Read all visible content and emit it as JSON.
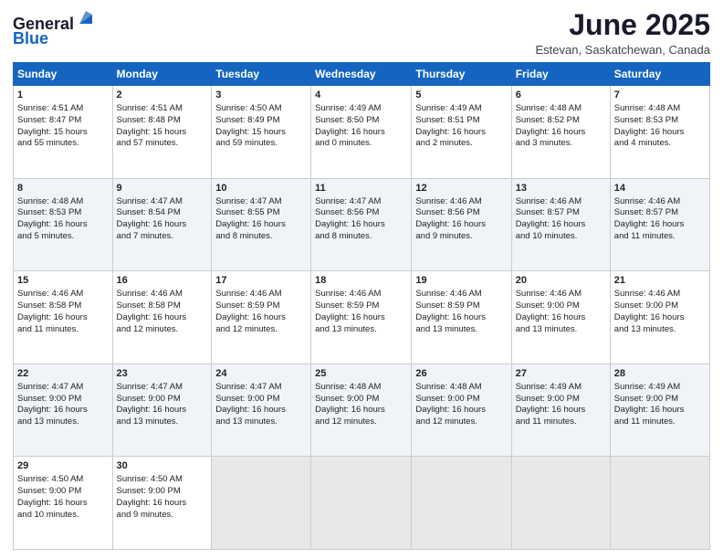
{
  "header": {
    "logo_general": "General",
    "logo_blue": "Blue",
    "month_title": "June 2025",
    "location": "Estevan, Saskatchewan, Canada"
  },
  "weekdays": [
    "Sunday",
    "Monday",
    "Tuesday",
    "Wednesday",
    "Thursday",
    "Friday",
    "Saturday"
  ],
  "weeks": [
    [
      {
        "day": "1",
        "info": "Sunrise: 4:51 AM\nSunset: 8:47 PM\nDaylight: 15 hours\nand 55 minutes."
      },
      {
        "day": "2",
        "info": "Sunrise: 4:51 AM\nSunset: 8:48 PM\nDaylight: 15 hours\nand 57 minutes."
      },
      {
        "day": "3",
        "info": "Sunrise: 4:50 AM\nSunset: 8:49 PM\nDaylight: 15 hours\nand 59 minutes."
      },
      {
        "day": "4",
        "info": "Sunrise: 4:49 AM\nSunset: 8:50 PM\nDaylight: 16 hours\nand 0 minutes."
      },
      {
        "day": "5",
        "info": "Sunrise: 4:49 AM\nSunset: 8:51 PM\nDaylight: 16 hours\nand 2 minutes."
      },
      {
        "day": "6",
        "info": "Sunrise: 4:48 AM\nSunset: 8:52 PM\nDaylight: 16 hours\nand 3 minutes."
      },
      {
        "day": "7",
        "info": "Sunrise: 4:48 AM\nSunset: 8:53 PM\nDaylight: 16 hours\nand 4 minutes."
      }
    ],
    [
      {
        "day": "8",
        "info": "Sunrise: 4:48 AM\nSunset: 8:53 PM\nDaylight: 16 hours\nand 5 minutes."
      },
      {
        "day": "9",
        "info": "Sunrise: 4:47 AM\nSunset: 8:54 PM\nDaylight: 16 hours\nand 7 minutes."
      },
      {
        "day": "10",
        "info": "Sunrise: 4:47 AM\nSunset: 8:55 PM\nDaylight: 16 hours\nand 8 minutes."
      },
      {
        "day": "11",
        "info": "Sunrise: 4:47 AM\nSunset: 8:56 PM\nDaylight: 16 hours\nand 8 minutes."
      },
      {
        "day": "12",
        "info": "Sunrise: 4:46 AM\nSunset: 8:56 PM\nDaylight: 16 hours\nand 9 minutes."
      },
      {
        "day": "13",
        "info": "Sunrise: 4:46 AM\nSunset: 8:57 PM\nDaylight: 16 hours\nand 10 minutes."
      },
      {
        "day": "14",
        "info": "Sunrise: 4:46 AM\nSunset: 8:57 PM\nDaylight: 16 hours\nand 11 minutes."
      }
    ],
    [
      {
        "day": "15",
        "info": "Sunrise: 4:46 AM\nSunset: 8:58 PM\nDaylight: 16 hours\nand 11 minutes."
      },
      {
        "day": "16",
        "info": "Sunrise: 4:46 AM\nSunset: 8:58 PM\nDaylight: 16 hours\nand 12 minutes."
      },
      {
        "day": "17",
        "info": "Sunrise: 4:46 AM\nSunset: 8:59 PM\nDaylight: 16 hours\nand 12 minutes."
      },
      {
        "day": "18",
        "info": "Sunrise: 4:46 AM\nSunset: 8:59 PM\nDaylight: 16 hours\nand 13 minutes."
      },
      {
        "day": "19",
        "info": "Sunrise: 4:46 AM\nSunset: 8:59 PM\nDaylight: 16 hours\nand 13 minutes."
      },
      {
        "day": "20",
        "info": "Sunrise: 4:46 AM\nSunset: 9:00 PM\nDaylight: 16 hours\nand 13 minutes."
      },
      {
        "day": "21",
        "info": "Sunrise: 4:46 AM\nSunset: 9:00 PM\nDaylight: 16 hours\nand 13 minutes."
      }
    ],
    [
      {
        "day": "22",
        "info": "Sunrise: 4:47 AM\nSunset: 9:00 PM\nDaylight: 16 hours\nand 13 minutes."
      },
      {
        "day": "23",
        "info": "Sunrise: 4:47 AM\nSunset: 9:00 PM\nDaylight: 16 hours\nand 13 minutes."
      },
      {
        "day": "24",
        "info": "Sunrise: 4:47 AM\nSunset: 9:00 PM\nDaylight: 16 hours\nand 13 minutes."
      },
      {
        "day": "25",
        "info": "Sunrise: 4:48 AM\nSunset: 9:00 PM\nDaylight: 16 hours\nand 12 minutes."
      },
      {
        "day": "26",
        "info": "Sunrise: 4:48 AM\nSunset: 9:00 PM\nDaylight: 16 hours\nand 12 minutes."
      },
      {
        "day": "27",
        "info": "Sunrise: 4:49 AM\nSunset: 9:00 PM\nDaylight: 16 hours\nand 11 minutes."
      },
      {
        "day": "28",
        "info": "Sunrise: 4:49 AM\nSunset: 9:00 PM\nDaylight: 16 hours\nand 11 minutes."
      }
    ],
    [
      {
        "day": "29",
        "info": "Sunrise: 4:50 AM\nSunset: 9:00 PM\nDaylight: 16 hours\nand 10 minutes."
      },
      {
        "day": "30",
        "info": "Sunrise: 4:50 AM\nSunset: 9:00 PM\nDaylight: 16 hours\nand 9 minutes."
      },
      {
        "day": "",
        "info": ""
      },
      {
        "day": "",
        "info": ""
      },
      {
        "day": "",
        "info": ""
      },
      {
        "day": "",
        "info": ""
      },
      {
        "day": "",
        "info": ""
      }
    ]
  ]
}
